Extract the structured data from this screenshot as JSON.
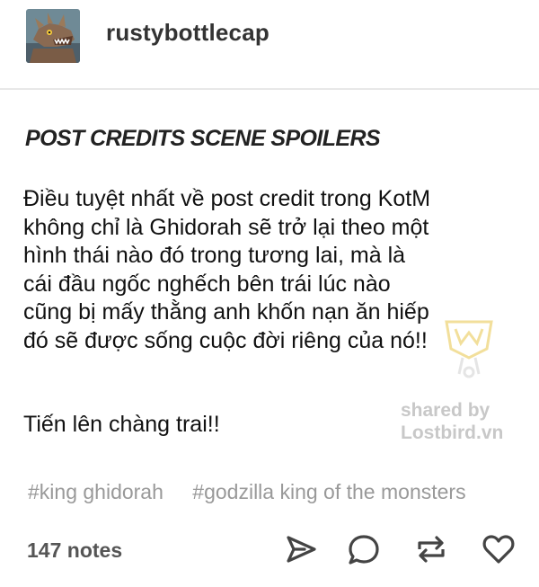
{
  "post": {
    "username": "rustybottlecap",
    "heading": "POST CREDITS SCENE SPOILERS",
    "body": "Điều tuyệt nhất về post credit trong KotM\nkhông chỉ là Ghidorah sẽ trở lại theo một\nhình thái nào đó trong tương lai, mà là\ncái đầu ngốc nghếch bên trái lúc nào\ncũng bị mấy thằng anh khốn nạn ăn hiếp\nđó sẽ được sống cuộc đời riêng của nó!!",
    "cheer": "Tiến lên chàng trai!!",
    "tags": [
      "#king ghidorah",
      "#godzilla king of the monsters"
    ]
  },
  "watermark": {
    "line1": "shared by",
    "line2": "Lostbird.vn"
  },
  "footer": {
    "notes": "147 notes"
  },
  "icons": {
    "avatar": "monster-avatar-icon",
    "share": "share-arrow-icon",
    "reply": "speech-bubble-icon",
    "reblog": "reblog-icon",
    "like": "heart-icon"
  },
  "colors": {
    "text": "#111111",
    "tags": "#999999",
    "icons": "#444444",
    "watermark": "#c8c8c8"
  }
}
